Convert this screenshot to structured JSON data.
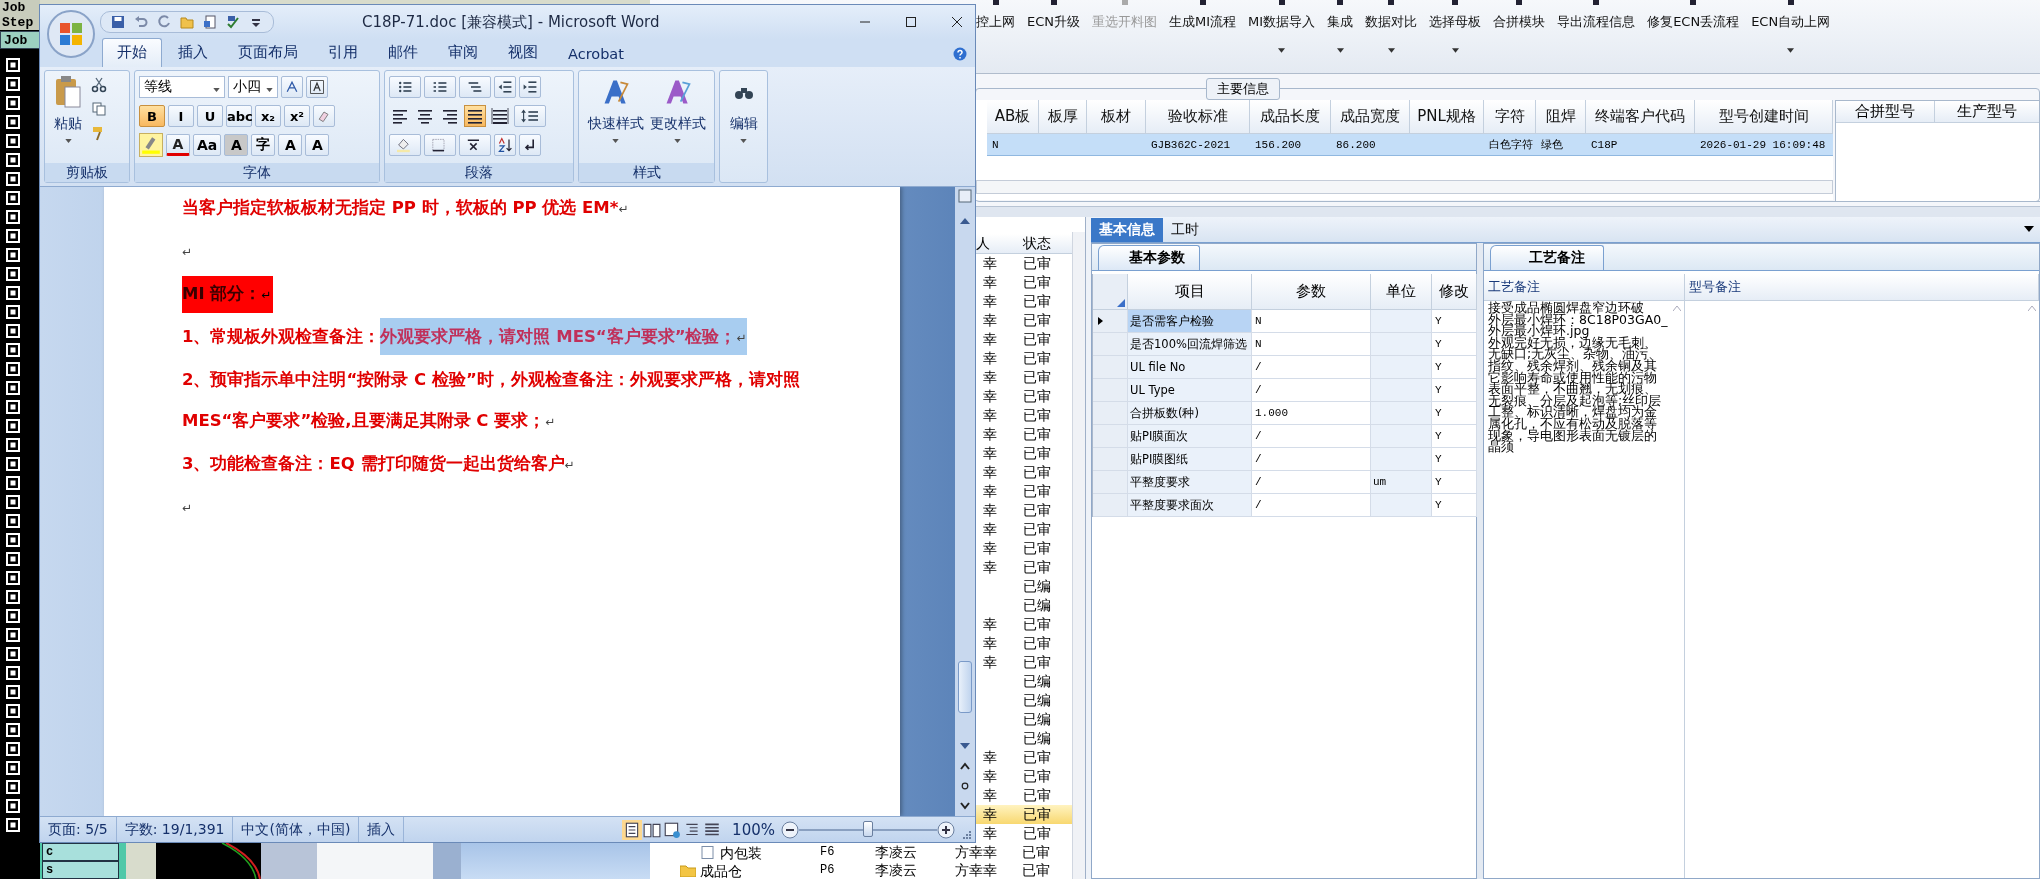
{
  "cam_app": {
    "labels": [
      "Job",
      "Step"
    ],
    "button": "Job",
    "cells": [
      "c",
      "s"
    ]
  },
  "word": {
    "title": "C18P-71.doc [兼容模式] - Microsoft Word",
    "tabs": [
      {
        "label": "开始",
        "selected": true
      },
      {
        "label": "插入",
        "selected": false
      },
      {
        "label": "页面布局",
        "selected": false
      },
      {
        "label": "引用",
        "selected": false
      },
      {
        "label": "邮件",
        "selected": false
      },
      {
        "label": "审阅",
        "selected": false
      },
      {
        "label": "视图",
        "selected": false
      },
      {
        "label": "Acrobat",
        "selected": false
      }
    ],
    "ribbon": {
      "clipboard": {
        "paste": "粘贴",
        "group": "剪贴板"
      },
      "font": {
        "name": "等线",
        "size": "小四",
        "group": "字体",
        "row2": [
          {
            "label": "B",
            "on": true
          },
          {
            "label": "I",
            "on": false
          },
          {
            "label": "U",
            "on": false
          },
          {
            "label": "abc",
            "on": false
          },
          {
            "label": "x₂",
            "on": false
          },
          {
            "label": "x²",
            "on": false
          }
        ],
        "row3": [
          "A",
          "Aa",
          "A",
          "字",
          "A",
          "A"
        ]
      },
      "paragraph": {
        "group": "段落",
        "align": [
          {
            "kind": "left",
            "on": false
          },
          {
            "kind": "center",
            "on": false
          },
          {
            "kind": "right",
            "on": false
          },
          {
            "kind": "justify",
            "on": true
          },
          {
            "kind": "distributed",
            "on": false
          }
        ]
      },
      "styles": {
        "group": "样式",
        "buttons": [
          "快速样式",
          "更改样式"
        ]
      },
      "editing": {
        "label": "编辑"
      }
    },
    "document": {
      "paragraphs": [
        {
          "segments": [
            {
              "text": "当客户指定软板板材无指定 PP 时，软板的 PP 优选 EM*",
              "highlighted": false,
              "selected": false
            }
          ],
          "mark": "↵"
        },
        {
          "mark": "↵"
        },
        {
          "segments": [
            {
              "text": "MI 部分：",
              "highlighted": true,
              "selected": false
            }
          ],
          "mark": "↵"
        },
        {
          "segments": [
            {
              "text": "1、常规板外观检查备注：",
              "highlighted": false,
              "selected": false
            },
            {
              "text": "外观要求严格，请对照 MES“客户要求”检验；",
              "highlighted": false,
              "selected": true
            }
          ],
          "mark": "↵"
        },
        {
          "segments": [
            {
              "text": "2、预审指示单中注明“按附录 C 检验”时，外观检查备注：外观要求严格，请对照 MES“客户要求”检验,且要满足其附录 C 要求；",
              "highlighted": false,
              "selected": false
            }
          ],
          "mark": "↵"
        },
        {
          "segments": [
            {
              "text": "3、功能检查备注：EQ 需打印随货一起出货给客户",
              "highlighted": false,
              "selected": false
            }
          ],
          "mark": "↵"
        },
        {
          "mark": "↵"
        }
      ]
    },
    "status_bar": {
      "items": [
        "页面: 5/5",
        "字数: 19/1,391",
        "中文(简体，中国)",
        "插入"
      ],
      "zoom": "100%",
      "zoom_slider": {
        "level": 0.5
      }
    }
  },
  "mes": {
    "toolbar": [
      {
        "label": "控上网",
        "disabled": false,
        "dropdown": false
      },
      {
        "label": "ECN升级",
        "disabled": false,
        "dropdown": false
      },
      {
        "label": "重选开料图",
        "disabled": true,
        "dropdown": false
      },
      {
        "label": "生成MI流程",
        "disabled": false,
        "dropdown": false
      },
      {
        "label": "MI数据导入",
        "disabled": false,
        "dropdown": true
      },
      {
        "label": "集成",
        "disabled": false,
        "dropdown": true
      },
      {
        "label": "数据对比",
        "disabled": false,
        "dropdown": true
      },
      {
        "label": "选择母板",
        "disabled": false,
        "dropdown": true
      },
      {
        "label": "合拼模块",
        "disabled": false,
        "dropdown": false
      },
      {
        "label": "导出流程信息",
        "disabled": false,
        "dropdown": false
      },
      {
        "label": "修复ECN丢流程",
        "disabled": false,
        "dropdown": false
      },
      {
        "label": "ECN自动上网",
        "disabled": false,
        "dropdown": true
      }
    ],
    "main_info": {
      "title": "主要信息",
      "columns": [
        "AB板",
        "板厚",
        "板材",
        "验收标准",
        "成品长度",
        "成品宽度",
        "PNL规格",
        "字符",
        "阻焊",
        "终端客户代码",
        "型号创建时间"
      ],
      "rows": [
        {
          "selected": true,
          "cells": [
            "N",
            null,
            null,
            "GJB362C-2021",
            "156.200",
            "86.200",
            null,
            "白色字符",
            "绿色",
            "C18P",
            "2026-01-29 16:09:48"
          ]
        }
      ],
      "side_columns": [
        "合拼型号",
        "生产型号"
      ]
    },
    "records": {
      "columns": [
        "人",
        "状态"
      ],
      "rows": [
        {
          "kind": "row",
          "approver": "幸",
          "status": "已审",
          "selected": false
        },
        {
          "kind": "row",
          "approver": "幸",
          "status": "已审",
          "selected": false
        },
        {
          "kind": "row",
          "approver": "幸",
          "status": "已审",
          "selected": false
        },
        {
          "kind": "row",
          "approver": "幸",
          "status": "已审",
          "selected": false
        },
        {
          "kind": "row",
          "approver": "幸",
          "status": "已审",
          "selected": false
        },
        {
          "kind": "row",
          "approver": "幸",
          "status": "已审",
          "selected": false
        },
        {
          "kind": "row",
          "approver": "幸",
          "status": "已审",
          "selected": false
        },
        {
          "kind": "row",
          "approver": "幸",
          "status": "已审",
          "selected": false
        },
        {
          "kind": "row",
          "approver": "幸",
          "status": "已审",
          "selected": false
        },
        {
          "kind": "row",
          "approver": "幸",
          "status": "已审",
          "selected": false
        },
        {
          "kind": "row",
          "approver": "幸",
          "status": "已审",
          "selected": false
        },
        {
          "kind": "row",
          "approver": "幸",
          "status": "已审",
          "selected": false
        },
        {
          "kind": "row",
          "approver": "幸",
          "status": "已审",
          "selected": false
        },
        {
          "kind": "row",
          "approver": "幸",
          "status": "已审",
          "selected": false
        },
        {
          "kind": "row",
          "approver": "幸",
          "status": "已审",
          "selected": false
        },
        {
          "kind": "row",
          "approver": "幸",
          "status": "已审",
          "selected": false
        },
        {
          "kind": "row",
          "approver": "幸",
          "status": "已审",
          "selected": false
        },
        {
          "kind": "row",
          "status": "已编",
          "selected": false
        },
        {
          "kind": "row",
          "status": "已编",
          "selected": false
        },
        {
          "kind": "row",
          "approver": "幸",
          "status": "已审",
          "selected": false
        },
        {
          "kind": "row",
          "approver": "幸",
          "status": "已审",
          "selected": false
        },
        {
          "kind": "row",
          "approver": "幸",
          "status": "已审",
          "selected": false
        },
        {
          "kind": "row",
          "status": "已编",
          "selected": false
        },
        {
          "kind": "row",
          "status": "已编",
          "selected": false
        },
        {
          "kind": "row",
          "status": "已编",
          "selected": false
        },
        {
          "kind": "row",
          "status": "已编",
          "selected": false
        },
        {
          "kind": "row",
          "approver": "幸",
          "status": "已审",
          "selected": false
        },
        {
          "kind": "row",
          "approver": "幸",
          "status": "已审",
          "selected": false
        },
        {
          "kind": "row",
          "approver": "幸",
          "status": "已审",
          "selected": false
        },
        {
          "kind": "row",
          "approver": "幸",
          "status": "已审",
          "selected": true
        },
        {
          "kind": "row",
          "approver": "幸",
          "status": "已审",
          "selected": false
        },
        {
          "kind": "file",
          "name": "内包装",
          "code": "F6",
          "maker": "李凌云",
          "approver": "方幸幸",
          "status": "已审",
          "selected": false
        },
        {
          "kind": "folder",
          "name": "成品仓",
          "code": "P6",
          "maker": "李凌云",
          "approver": "方幸幸",
          "status": "已审",
          "selected": false
        }
      ]
    },
    "tabs": [
      {
        "label": "基本信息",
        "selected": true
      },
      {
        "label": "工时",
        "selected": false
      }
    ],
    "params": {
      "tab": "基本参数",
      "columns": [
        "项目",
        "参数",
        "单位",
        "修改"
      ],
      "rows": [
        {
          "item": "是否需客户检验",
          "value": "N",
          "modify": "Y",
          "selected": true
        },
        {
          "item": "是否100%回流焊筛选",
          "value": "N",
          "modify": "Y",
          "selected": false
        },
        {
          "item": "UL file No",
          "value": "/",
          "modify": "Y",
          "selected": false
        },
        {
          "item": "UL Type",
          "value": "/",
          "modify": "Y",
          "selected": false
        },
        {
          "item": "合拼板数(种)",
          "value": "1.000",
          "modify": "Y",
          "selected": false
        },
        {
          "item": "贴PI膜面次",
          "value": "/",
          "modify": "Y",
          "selected": false
        },
        {
          "item": "贴PI膜图纸",
          "value": "/",
          "modify": "Y",
          "selected": false
        },
        {
          "item": "平整度要求",
          "value": "/",
          "unit": "um",
          "modify": "Y",
          "selected": false
        },
        {
          "item": "平整度要求面次",
          "value": "/",
          "modify": "Y",
          "selected": false
        }
      ]
    },
    "notes": {
      "tab": "工艺备注",
      "columns": [
        "工艺备注",
        "型号备注"
      ],
      "process_notes": [
        "接受成品椭圆焊盘窄边环破",
        "外层最小焊环：8C18P03GA0_外层最小焊环.jpg",
        "外观完好无损，边缘无毛刺、无缺口;无灰尘、杂物、油污、指纹、残余焊剂、残余铜及其它影响寿命或使用性能的污物",
        "表面平整，不曲翘，无划痕、无裂痕、分层及起泡等;丝印层工整、标识清晰，焊盘均为金属化孔，不应有松动及脱落等现象，导电图形表面无镀层的晶须"
      ]
    }
  }
}
